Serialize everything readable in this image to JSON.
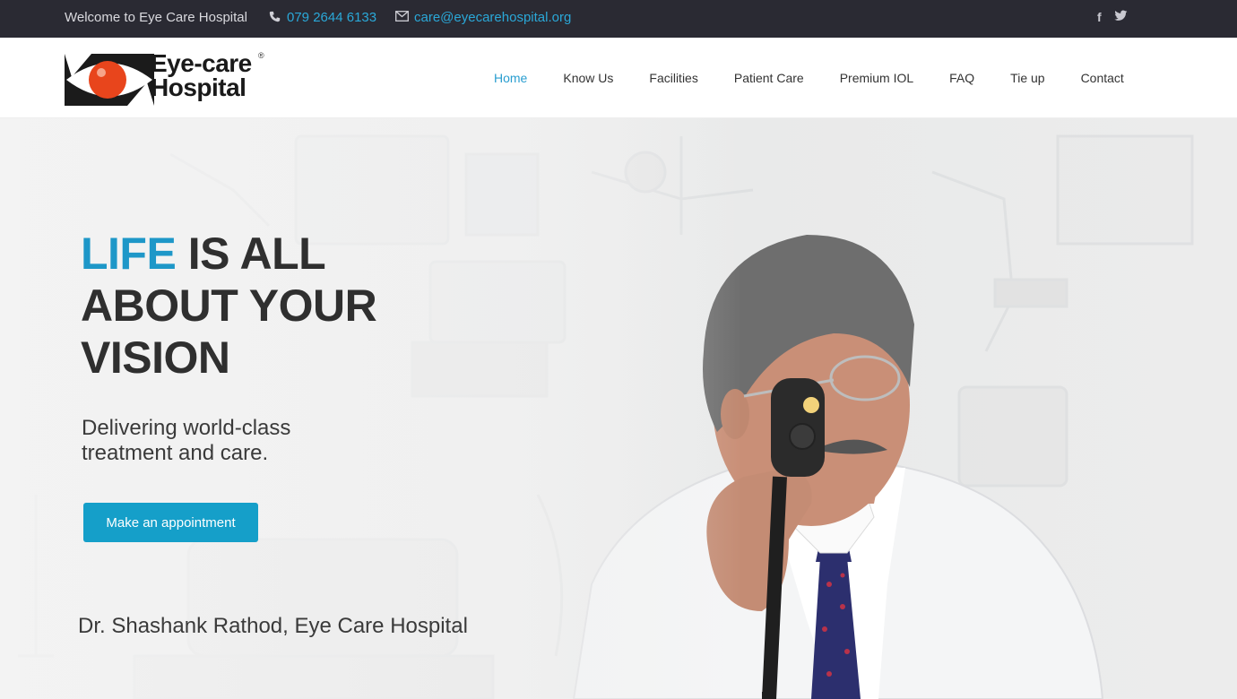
{
  "topbar": {
    "welcome": "Welcome to Eye Care Hospital",
    "phone": "079 2644 6133",
    "email": "care@eyecarehospital.org",
    "phone_icon": "phone-icon",
    "mail_icon": "mail-icon",
    "social": [
      "facebook-icon",
      "twitter-icon"
    ],
    "social_glyphs": {
      "facebook": "f",
      "twitter": "t"
    }
  },
  "logo": {
    "line1": "Eye-care",
    "line2": "Hospital",
    "reg": "®"
  },
  "nav": {
    "items": [
      "Home",
      "Know Us",
      "Facilities",
      "Patient Care",
      "Premium IOL",
      "FAQ",
      "Tie up",
      "Contact"
    ],
    "active": "Home"
  },
  "hero": {
    "headline_accent": "LIFE",
    "headline_rest1": " IS ALL",
    "headline_rest2": "ABOUT YOUR",
    "headline_rest3": "VISION",
    "subtitle": "Delivering world-class treatment and care.",
    "cta_label": "Make an appointment",
    "caption": "Dr. Shashank Rathod, Eye Care Hospital"
  },
  "colors": {
    "topbar_bg": "#2a2a33",
    "accent": "#1e97c8",
    "button": "#159fc9",
    "logo_eye": "#e8451c"
  }
}
